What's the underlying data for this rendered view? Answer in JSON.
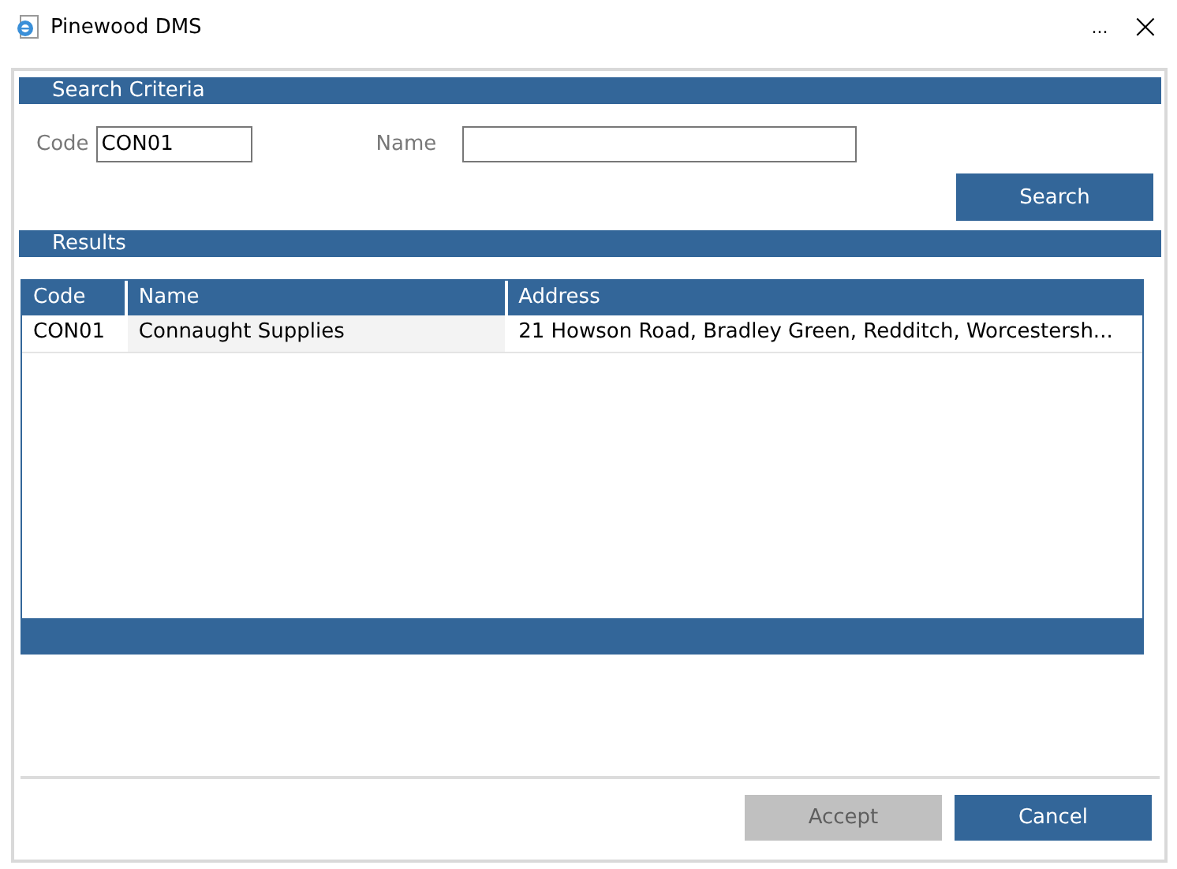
{
  "window": {
    "title": "Pinewood DMS",
    "more": "...",
    "close": "×"
  },
  "search_criteria": {
    "heading": "Search Criteria",
    "fields": [
      {
        "label": "Code",
        "value": "CON01"
      },
      {
        "label": "Name"
      }
    ],
    "button": "Search"
  },
  "results": {
    "heading": "Results",
    "columns": [
      "Code",
      "Name",
      "Address"
    ],
    "rows": [
      {
        "cells": [
          "CON01",
          "Connaught Supplies",
          "21 Howson Road, Bradley Green, Redditch, Worcestersh..."
        ],
        "selected": false
      }
    ]
  },
  "buttons": [
    {
      "label": "Accept",
      "disabled": true
    },
    {
      "label": "Cancel",
      "disabled": false
    }
  ]
}
